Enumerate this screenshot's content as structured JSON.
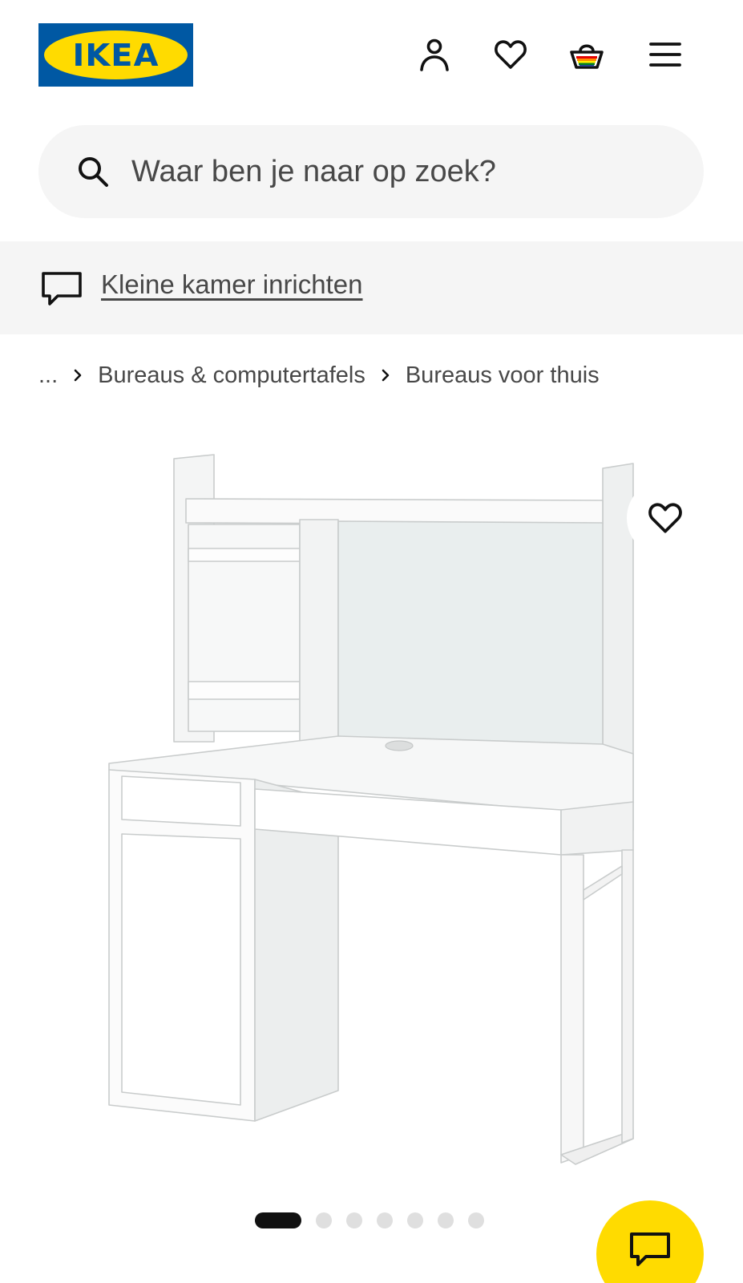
{
  "header": {
    "logo_text": "IKEA",
    "icons": [
      "profile-icon",
      "heart-icon",
      "shopping-bag-icon",
      "menu-icon"
    ]
  },
  "search": {
    "placeholder": "Waar ben je naar op zoek?"
  },
  "banner": {
    "icon": "chat-bubble-icon",
    "link_text": "Kleine kamer inrichten"
  },
  "breadcrumb": {
    "ellipsis": "...",
    "items": [
      "Bureaus & computertafels",
      "Bureaus voor thuis"
    ]
  },
  "gallery": {
    "image_count": 7,
    "active_index": 0,
    "favorite_icon": "heart-icon"
  },
  "chat_fab": {
    "icon": "chat-bubble-icon"
  },
  "colors": {
    "brand_blue": "#0058a3",
    "brand_yellow": "#ffdb00",
    "panel_grey": "#f5f5f5",
    "text": "#111111",
    "muted_text": "#484848"
  }
}
